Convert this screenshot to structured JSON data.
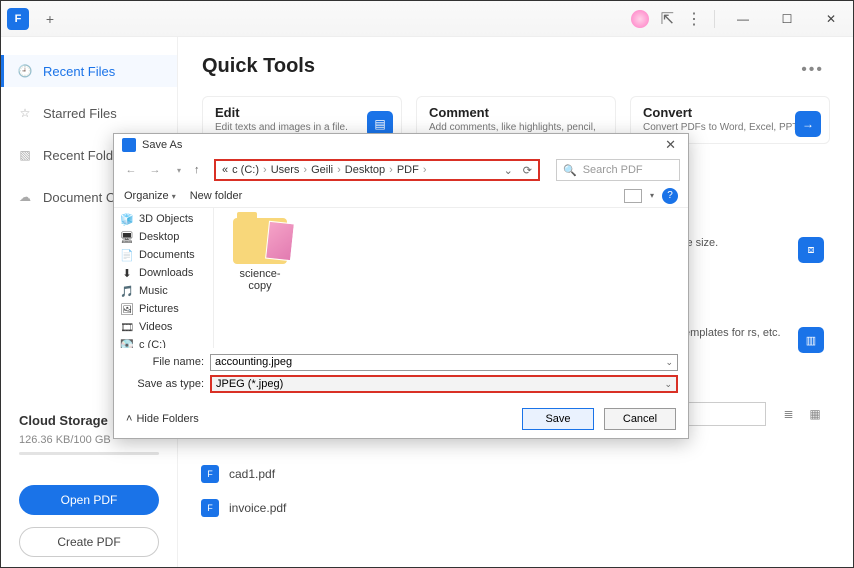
{
  "titlebar": {
    "home_glyph": "F"
  },
  "sidebar": {
    "items": [
      {
        "label": "Recent Files",
        "icon": "clock-icon"
      },
      {
        "label": "Starred Files",
        "icon": "star-icon"
      },
      {
        "label": "Recent Folders",
        "icon": "folder-icon"
      },
      {
        "label": "Document Clo…",
        "icon": "cloud-icon"
      }
    ],
    "cloud": {
      "title": "Cloud Storage",
      "usage": "126.36 KB/100 GB"
    },
    "open_btn": "Open PDF",
    "create_btn": "Create PDF"
  },
  "content": {
    "title": "Quick Tools",
    "cards": [
      {
        "title": "Edit",
        "desc": "Edit texts and images in a file."
      },
      {
        "title": "Comment",
        "desc": "Add comments, like highlights, pencil, stamps, etc."
      },
      {
        "title": "Convert",
        "desc": "Convert PDFs to Word, Excel, PPT, etc."
      }
    ],
    "peek1": "le size.",
    "peek2": "emplates for rs, etc.",
    "files": [
      {
        "name": "cad1.pdf"
      },
      {
        "name": "invoice.pdf"
      }
    ]
  },
  "dialog": {
    "title": "Save As",
    "breadcrumb": [
      "«",
      "c (C:)",
      "Users",
      "Geili",
      "Desktop",
      "PDF"
    ],
    "search_placeholder": "Search PDF",
    "organize": "Organize",
    "newfolder": "New folder",
    "tree": [
      {
        "label": "3D Objects",
        "glyph": "🧊"
      },
      {
        "label": "Desktop",
        "glyph": "🖥"
      },
      {
        "label": "Documents",
        "glyph": "📄"
      },
      {
        "label": "Downloads",
        "glyph": "⬇"
      },
      {
        "label": "Music",
        "glyph": "🎵"
      },
      {
        "label": "Pictures",
        "glyph": "🖼"
      },
      {
        "label": "Videos",
        "glyph": "🎞"
      },
      {
        "label": "c (C:)",
        "glyph": "💽"
      }
    ],
    "folder_item": "science-copy",
    "filename_label": "File name:",
    "filename_value": "accounting.jpeg",
    "type_label": "Save as type:",
    "type_value": "JPEG (*.jpeg)",
    "hide": "Hide Folders",
    "save": "Save",
    "cancel": "Cancel"
  }
}
